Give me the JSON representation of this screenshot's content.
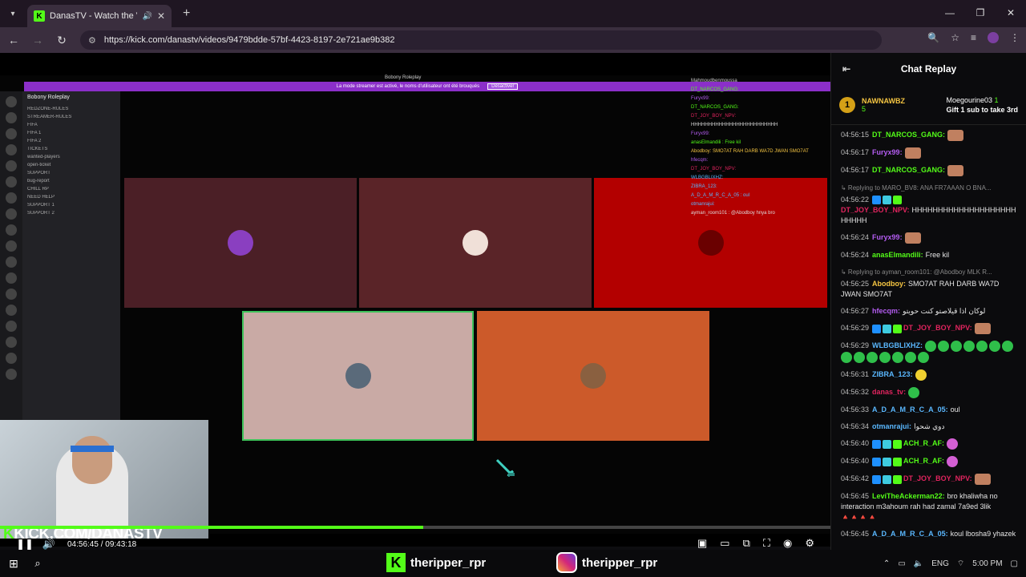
{
  "browser": {
    "tab_title": "DanasTV - Watch the VOD",
    "url": "https://kick.com/danastv/videos/9479bdde-57bf-4423-8197-2e721ae9b382"
  },
  "stream": {
    "discord_title": "Bobony Roleplay",
    "banner_text": "La mode streamer est activé, le noms d'utilisateur ont été brouqués",
    "banner_button": "Désactiver",
    "server_name": "Bobony Roleplay",
    "channels": [
      "REDZONE-RULES",
      "STREAMER-RULES",
      "FIFA",
      "FIFA 1",
      "FIFA 2",
      "TICKETS",
      "wanted-players",
      "open-ticket",
      "SUPPORT",
      "bug-report",
      "CHILL RP",
      "NEED HELP",
      "SUPPORT 1",
      "SUPPORT 2"
    ],
    "overlay_chat": [
      "Mahmoudbenmoussa",
      "DT_NARCOS_GANG:",
      "Furyx99:",
      "DT_NARCOS_GANG:",
      "DT_JOY_BOY_NPV:",
      "HHHHHHHHHHHHHHHHHHHHHHHHH",
      "Furyx99:",
      "anasElmandili : Free kil",
      "Abodboy: SMO7AT RAH DARB WA7D JWAN SMO7AT",
      "hfecqm:",
      "DT_JOY_BOY_NPV:",
      "WLBGBLIXHZ:",
      "ZIBRA_123:",
      "A_D_A_M_R_C_A_05 : oul",
      "otmanrajui:",
      "ayman_room101 : @Abodboy hnya bro"
    ],
    "webcam_logo": "KICK.COM/DANASTV",
    "tile_colors": [
      "#4b1f26",
      "#5a2428",
      "#b30000",
      "#c9aaa5",
      "#cc5a2a"
    ]
  },
  "player": {
    "current_time": "04:56:45",
    "duration": "09:43:18",
    "time_display": "04:56:45 / 09:43:18",
    "progress": 0.51
  },
  "chat": {
    "header": "Chat Replay",
    "pinned": {
      "user": "NAWNAWBZ",
      "count": "5",
      "gifter": "Moegourine03",
      "gifter_count": "1",
      "message": "Gift 1 sub to take 3rd"
    },
    "messages": [
      {
        "time": "04:56:15",
        "user": "DT_NARCOS_GANG:",
        "color": "#53fc18",
        "text": "",
        "emote": "face"
      },
      {
        "time": "04:56:17",
        "user": "Furyx99:",
        "color": "#b35cf0",
        "text": "",
        "emote": "face"
      },
      {
        "time": "04:56:17",
        "user": "DT_NARCOS_GANG:",
        "color": "#53fc18",
        "text": "",
        "emote": "face"
      },
      {
        "reply": "Replying to MARO_BV8: ANA FR7AAAN O BNA...",
        "time": "04:56:22",
        "user": "DT_JOY_BOY_NPV:",
        "color": "#e0245e",
        "text": "HHHHHHHHHHHHHHHHHHHHHHHHH",
        "badges": true
      },
      {
        "time": "04:56:24",
        "user": "Furyx99:",
        "color": "#b35cf0",
        "text": "",
        "emote": "face"
      },
      {
        "time": "04:56:24",
        "user": "anasElmandili:",
        "color": "#53fc18",
        "text": "Free kil"
      },
      {
        "reply": "Replying to ayman_room101: @Abodboy MLK R...",
        "time": "04:56:25",
        "user": "Abodboy:",
        "color": "#f5c542",
        "text": "SMO7AT RAH DARB WA7D JWAN SMO7AT"
      },
      {
        "time": "04:56:27",
        "user": "hfecqm:",
        "color": "#b35cf0",
        "text": "لوكان اذا قيلاصتو كنت حويتو"
      },
      {
        "time": "04:56:29",
        "user": "DT_JOY_BOY_NPV:",
        "color": "#e0245e",
        "text": "",
        "badges": true,
        "emote": "face"
      },
      {
        "time": "04:56:29",
        "user": "WLBGBLIXHZ:",
        "color": "#5ab8ff",
        "text": "",
        "emote": "green",
        "emote_count": 14
      },
      {
        "time": "04:56:31",
        "user": "ZIBRA_123:",
        "color": "#5ab8ff",
        "text": "",
        "emote": "yel"
      },
      {
        "time": "04:56:32",
        "user": "danas_tv:",
        "color": "#e0245e",
        "text": "",
        "emote": "green"
      },
      {
        "time": "04:56:33",
        "user": "A_D_A_M_R_C_A_05:",
        "color": "#5ab8ff",
        "text": "oul"
      },
      {
        "time": "04:56:34",
        "user": "otmanrajui:",
        "color": "#5ab8ff",
        "text": "دوي شحوا"
      },
      {
        "time": "04:56:40",
        "user": "ACH_R_AF:",
        "color": "#53fc18",
        "text": "",
        "badges": true,
        "emote": "pink"
      },
      {
        "time": "04:56:40",
        "user": "ACH_R_AF:",
        "color": "#53fc18",
        "text": "",
        "badges": true,
        "emote": "pink"
      },
      {
        "time": "04:56:42",
        "user": "DT_JOY_BOY_NPV:",
        "color": "#e0245e",
        "text": "",
        "badges": true,
        "emote": "face"
      },
      {
        "time": "04:56:45",
        "user": "LeviTheAckerman22:",
        "color": "#53fc18",
        "text": "bro khaliwha no interaction m3ahoum rah had zamal 7a9ed 3lik 🔺🔺🔺🔺"
      },
      {
        "time": "04:56:45",
        "user": "A_D_A_M_R_C_A_05:",
        "color": "#5ab8ff",
        "text": "koul lbosha9 yhazek"
      }
    ]
  },
  "taskbar": {
    "kick_handle": "theripper_rpr",
    "ig_handle": "theripper_rpr",
    "lang": "ENG",
    "clock": "5:00 PM"
  }
}
